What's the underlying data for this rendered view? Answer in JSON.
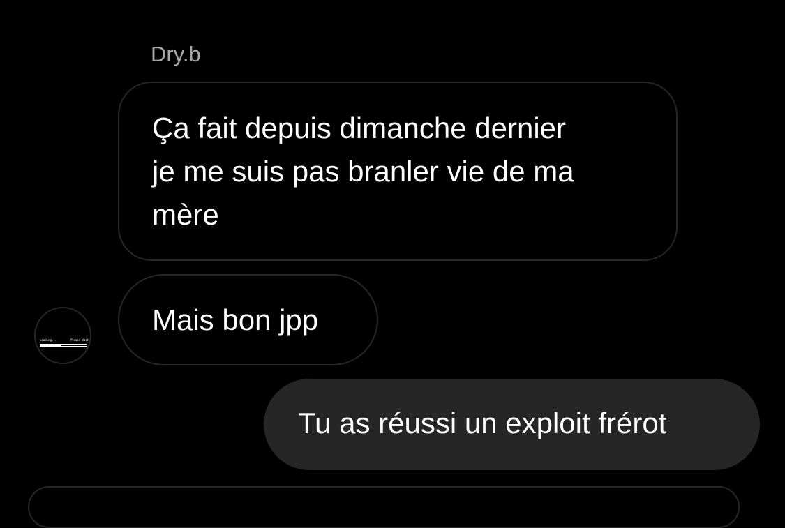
{
  "conversation": {
    "sender_name": "Dry.b",
    "avatar": {
      "loading_text": "Loading...",
      "wait_text": "Please Wait",
      "progress": 0.45
    },
    "messages": [
      {
        "direction": "received",
        "text": "Ça fait depuis dimanche dernier\nje me suis pas branler vie de ma\nmère"
      },
      {
        "direction": "received",
        "text": "Mais bon jpp"
      },
      {
        "direction": "sent",
        "text": "Tu as réussi un exploit frérot"
      }
    ]
  },
  "colors": {
    "background": "#000000",
    "received_border": "#262626",
    "sent_bubble": "#262626",
    "sender_name": "#a8a8a8",
    "text": "#ffffff"
  }
}
